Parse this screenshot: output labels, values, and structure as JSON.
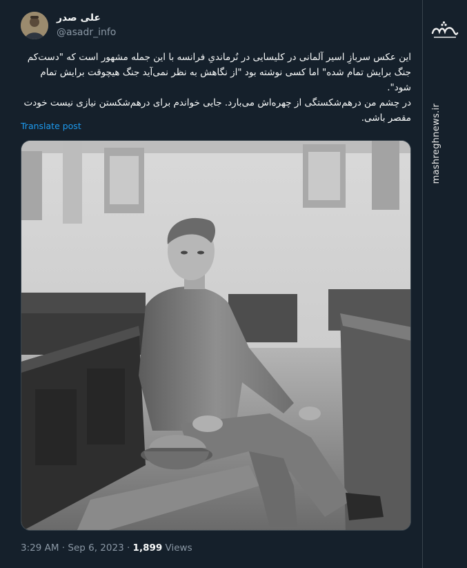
{
  "author": {
    "display_name": "علی صدر",
    "handle": "@asadr_info"
  },
  "post": {
    "lines": [
      "این عکس سربازِ اسیر آلمانی در کلیسایی در نُرماندیِ فرانسه با این جمله مشهور است که \"دست‌کم جنگ برایش تمام شده\" اما کسی نوشته بود \"از نگاهش به نظر نمی‌آید جنگ هیچوقت برایش تمام شود\".",
      "در چشم من درهم‌شکستگی از چهره‌اش می‌بارد. جایی خواندم برای درهم‌شکستن نیازی نیست خودت مقصر باشی."
    ],
    "translate_label": "Translate post"
  },
  "meta": {
    "time": "3:29 AM",
    "date": "Sep 6, 2023",
    "separator": "·",
    "views_count": "1,899",
    "views_label": "Views"
  },
  "watermark": {
    "logo_text": "مشرق",
    "url": "mashreghnews.ir"
  }
}
